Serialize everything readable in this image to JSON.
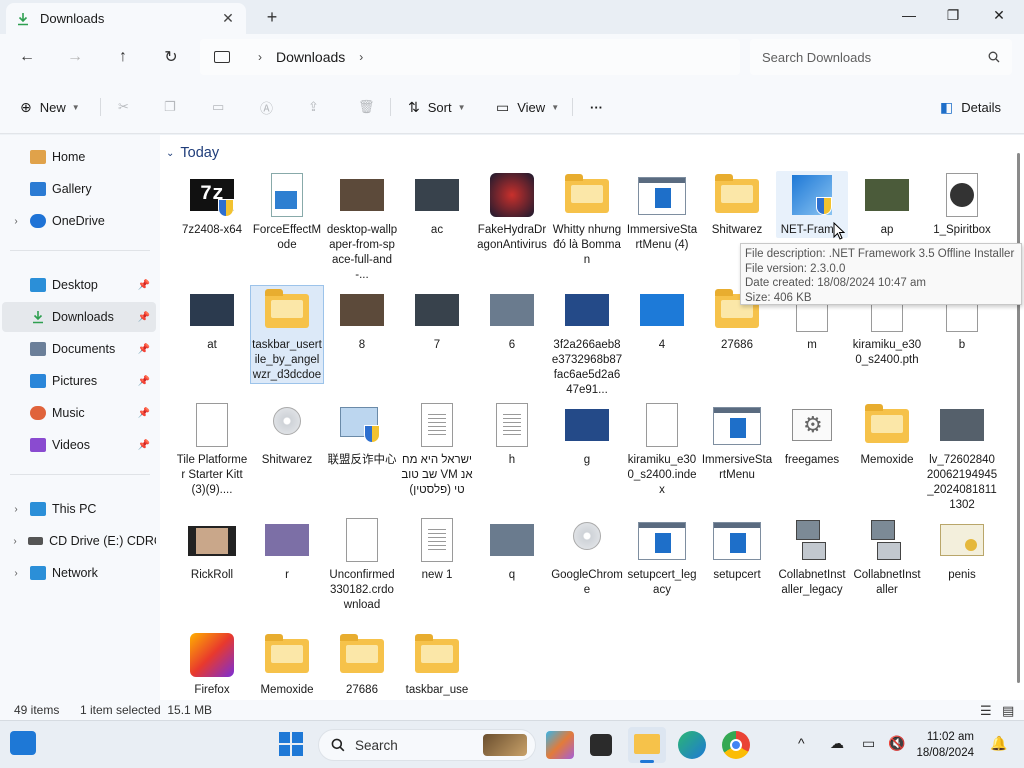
{
  "window": {
    "tab_title": "Downloads",
    "new_tab": "+",
    "minimize": "—",
    "maximize": "❐",
    "close": "✕"
  },
  "address": {
    "location": "This PC",
    "path": [
      "Downloads"
    ],
    "search_placeholder": "Search Downloads"
  },
  "commands": {
    "new": "New",
    "sort": "Sort",
    "view": "View",
    "more": "···",
    "details": "Details"
  },
  "sidebar": {
    "quick": [
      {
        "label": "Home",
        "color": "#e0a24a"
      },
      {
        "label": "Gallery",
        "color": "#2b7bd3"
      },
      {
        "label": "OneDrive",
        "color": "#1f73d6"
      }
    ],
    "pinned": [
      {
        "label": "Desktop",
        "color": "#2b8fd8"
      },
      {
        "label": "Downloads",
        "color": "#2e9f50"
      },
      {
        "label": "Documents",
        "color": "#6b7f99"
      },
      {
        "label": "Pictures",
        "color": "#2a86d9"
      },
      {
        "label": "Music",
        "color": "#e0633b"
      },
      {
        "label": "Videos",
        "color": "#8a4bd0"
      }
    ],
    "devices": [
      {
        "label": "This PC",
        "color": "#2b8fd8"
      },
      {
        "label": "CD Drive (E:) CDRO",
        "color": "#555"
      },
      {
        "label": "Network",
        "color": "#2b8fd8"
      }
    ]
  },
  "group": {
    "title": "Today"
  },
  "files": [
    {
      "name": "7z2408-x64",
      "icon": "7z-icon"
    },
    {
      "name": "ForceEffectMode",
      "icon": "registry-icon"
    },
    {
      "name": "desktop-wallpaper-from-space-full-and-...",
      "icon": "image-icon"
    },
    {
      "name": "ac",
      "icon": "image-icon"
    },
    {
      "name": "FakeHydraDragonAntivirus",
      "icon": "app-icon"
    },
    {
      "name": "Whitty nhưng đó là Bomman",
      "icon": "folder-icon"
    },
    {
      "name": "ImmersiveStartMenu (4)",
      "icon": "window-app-icon"
    },
    {
      "name": "Shitwarez",
      "icon": "folder-icon"
    },
    {
      "name": "NET-Fram...",
      "icon": "installer-icon"
    },
    {
      "name": "ap",
      "icon": "image-icon"
    },
    {
      "name": "1_Spiritbox",
      "icon": "media-icon"
    },
    {
      "name": "at",
      "icon": "image-icon"
    },
    {
      "name": "taskbar_usertile_by_angelwzr_d3dcdoe",
      "icon": "folder-icon"
    },
    {
      "name": "8",
      "icon": "image-icon"
    },
    {
      "name": "7",
      "icon": "image-icon"
    },
    {
      "name": "6",
      "icon": "image-icon"
    },
    {
      "name": "3f2a266aeb8e3732968b87fac6ae5d2a647e91...",
      "icon": "image-icon"
    },
    {
      "name": "4",
      "icon": "image-icon"
    },
    {
      "name": "27686",
      "icon": "folder-icon"
    },
    {
      "name": "m",
      "icon": "document-icon"
    },
    {
      "name": "kiramiku_e300_s2400.pth",
      "icon": "document-icon"
    },
    {
      "name": "b",
      "icon": "document-icon"
    },
    {
      "name": "Tile Platformer Starter Kitt(3)(9)....",
      "icon": "document-icon"
    },
    {
      "name": "Shitwarez",
      "icon": "disc-icon"
    },
    {
      "name": "联盟反诈中心",
      "icon": "setup-icon"
    },
    {
      "name": "ישראל היא מחשב טוב VM אנטי (פלסטין)",
      "icon": "text-document-icon"
    },
    {
      "name": "h",
      "icon": "text-document-icon"
    },
    {
      "name": "g",
      "icon": "image-icon"
    },
    {
      "name": "kiramiku_e300_s2400.index",
      "icon": "document-icon"
    },
    {
      "name": "ImmersiveStartMenu",
      "icon": "window-app-icon"
    },
    {
      "name": "freegames",
      "icon": "settings-file-icon"
    },
    {
      "name": "Memoxide",
      "icon": "folder-icon"
    },
    {
      "name": "lv_7260284020062194945_20240818111302",
      "icon": "image-icon"
    },
    {
      "name": "RickRoll",
      "icon": "video-icon"
    },
    {
      "name": "r",
      "icon": "image-icon"
    },
    {
      "name": "Unconfirmed 330182.crdownload",
      "icon": "document-icon"
    },
    {
      "name": "new 1",
      "icon": "text-document-icon"
    },
    {
      "name": "q",
      "icon": "image-icon"
    },
    {
      "name": "GoogleChrome",
      "icon": "disc-icon"
    },
    {
      "name": "setupcert_legacy",
      "icon": "window-app-icon"
    },
    {
      "name": "setupcert",
      "icon": "window-app-icon"
    },
    {
      "name": "CollabnetInstaller_legacy",
      "icon": "network-setup-icon"
    },
    {
      "name": "CollabnetInstaller",
      "icon": "network-setup-icon"
    },
    {
      "name": "penis",
      "icon": "certificate-icon"
    },
    {
      "name": "Firefox",
      "icon": "app-icon"
    },
    {
      "name": "Memoxide",
      "icon": "folder-icon"
    },
    {
      "name": "27686",
      "icon": "folder-icon"
    },
    {
      "name": "taskbar_use",
      "icon": "folder-icon"
    }
  ],
  "tooltip": {
    "line1": "File description: .NET Framework 3.5 Offline Installer",
    "line2": "File version: 2.3.0.0",
    "line3": "Date created: 18/08/2024 10:47 am",
    "line4": "Size: 406 KB"
  },
  "status": {
    "items": "49 items",
    "selected": "1 item selected  15.1 MB"
  },
  "taskbar": {
    "search": "Search",
    "time": "11:02 am",
    "date": "18/08/2024"
  }
}
